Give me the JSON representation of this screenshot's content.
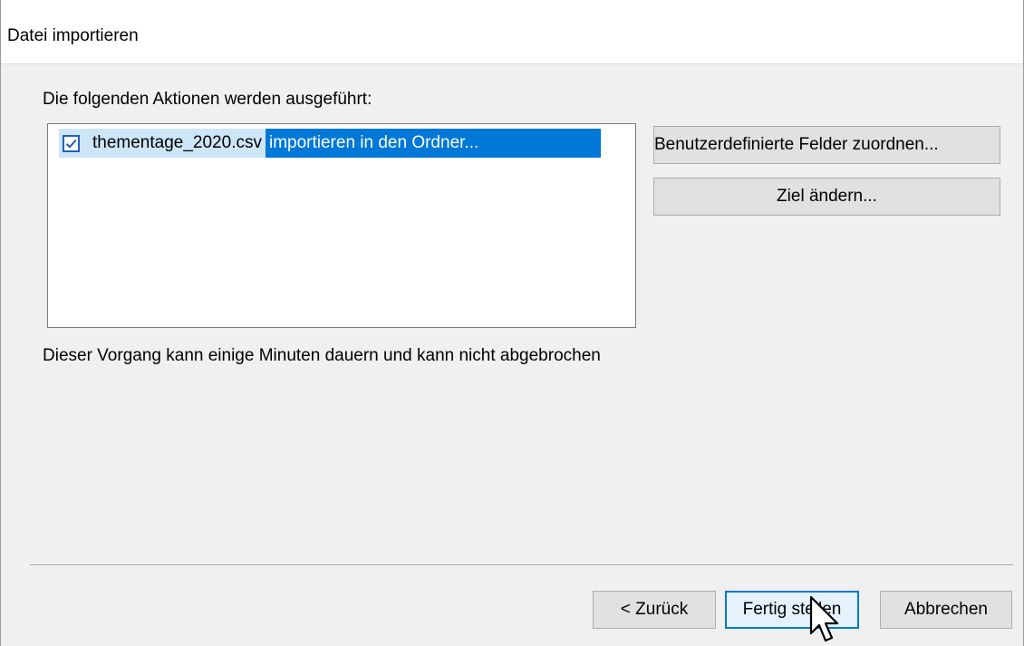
{
  "window": {
    "title": "Datei importieren"
  },
  "main": {
    "intro_label": "Die folgenden Aktionen werden ausgeführt:",
    "actions": [
      {
        "checked": true,
        "file": "thementage_2020.csv",
        "action": "importieren in den Ordner..."
      }
    ],
    "note": "Dieser Vorgang kann einige Minuten dauern und kann nicht abgebrochen"
  },
  "side_buttons": {
    "map_fields_label": "Benutzerdefinierte Felder zuordnen...",
    "change_target_label": "Ziel ändern..."
  },
  "footer": {
    "back_label": "< Zurück",
    "finish_label": "Fertig stellen",
    "cancel_label": "Abbrechen"
  },
  "colors": {
    "selection": "#0078d7",
    "selection_light": "#cde6f7",
    "checkbox_border": "#1f5fbf",
    "default_button_border": "#0078d7"
  },
  "icons": {
    "checkbox": "checkmark-icon",
    "cursor": "mouse-pointer-icon"
  }
}
